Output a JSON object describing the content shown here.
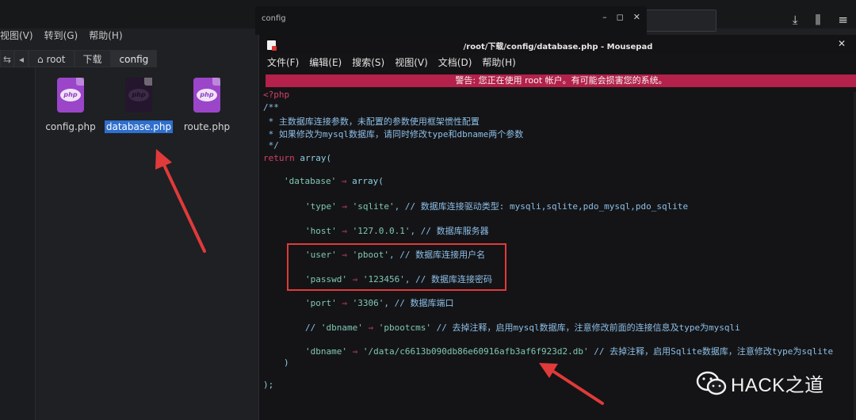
{
  "file_manager": {
    "menu": [
      "视图(V)",
      "转到(G)",
      "帮助(H)"
    ],
    "breadcrumbs": [
      "root",
      "下载",
      "config"
    ],
    "files": [
      {
        "name": "config.php",
        "selected": false
      },
      {
        "name": "database.php",
        "selected": true
      },
      {
        "name": "route.php",
        "selected": false
      }
    ]
  },
  "outer_window": {
    "title": "config",
    "buttons": [
      "–",
      "◻",
      "✕"
    ]
  },
  "mousepad": {
    "title": "/root/下载/config/database.php - Mousepad",
    "close": "✕",
    "menu": [
      "文件(F)",
      "编辑(E)",
      "搜索(S)",
      "视图(V)",
      "文档(D)",
      "帮助(H)"
    ],
    "warning": "警告: 您正在使用 root 帐户。有可能会损害您的系统。"
  },
  "code": {
    "l1": "<?php",
    "l2": "/**",
    "l3": " * 主数据库连接参数，未配置的参数使用框架惯性配置",
    "l4": " * 如果修改为mysql数据库，请同时修改type和dbname两个参数",
    "l5": " */",
    "l6_kw": "return",
    "l6_rest": " array(",
    "l7_key": "'database'",
    "l7_arrow": " ⇒ ",
    "l7_rest": "array(",
    "l8_key": "'type'",
    "l8_arrow": " ⇒ ",
    "l8_val": "'sqlite'",
    "l8_cmt": ", // 数据库连接驱动类型: mysqli,sqlite,pdo_mysql,pdo_sqlite",
    "l9_key": "'host'",
    "l9_arrow": " ⇒ ",
    "l9_val": "'127.0.0.1'",
    "l9_cmt": ", // 数据库服务器",
    "l10_key": "'user'",
    "l10_arrow": " ⇒ ",
    "l10_val": "'pboot'",
    "l10_cmt": ", // 数据库连接用户名",
    "l11_key": "'passwd'",
    "l11_arrow": " ⇒ ",
    "l11_val": "'123456'",
    "l11_cmt": ", // 数据库连接密码",
    "l12_key": "'port'",
    "l12_arrow": " ⇒ ",
    "l12_val": "'3306'",
    "l12_cmt": ", // 数据库端口",
    "l13_pre": "// ",
    "l13_key": "'dbname'",
    "l13_arrow": " ⇒ ",
    "l13_val": "'pbootcms'",
    "l13_cmt": " // 去掉注释，启用mysql数据库，注意修改前面的连接信息及type为mysqli",
    "l14_key": "'dbname'",
    "l14_arrow": " ⇒ ",
    "l14_val": "'/data/c6613b090db86e60916afb3af6f923d2.db'",
    "l14_cmt": " // 去掉注释，启用Sqlite数据库，注意修改type为sqlite",
    "l15": ")",
    "l16": ");"
  },
  "watermark": "HACK之道",
  "colors": {
    "warning_bg": "#b4214a",
    "keyword": "#d63f6b",
    "string": "#80c7b5",
    "comment": "#8dbfe8",
    "annotation_red": "#e03a3a",
    "selection": "#2f6fce",
    "php_icon": "#9b45c9"
  }
}
